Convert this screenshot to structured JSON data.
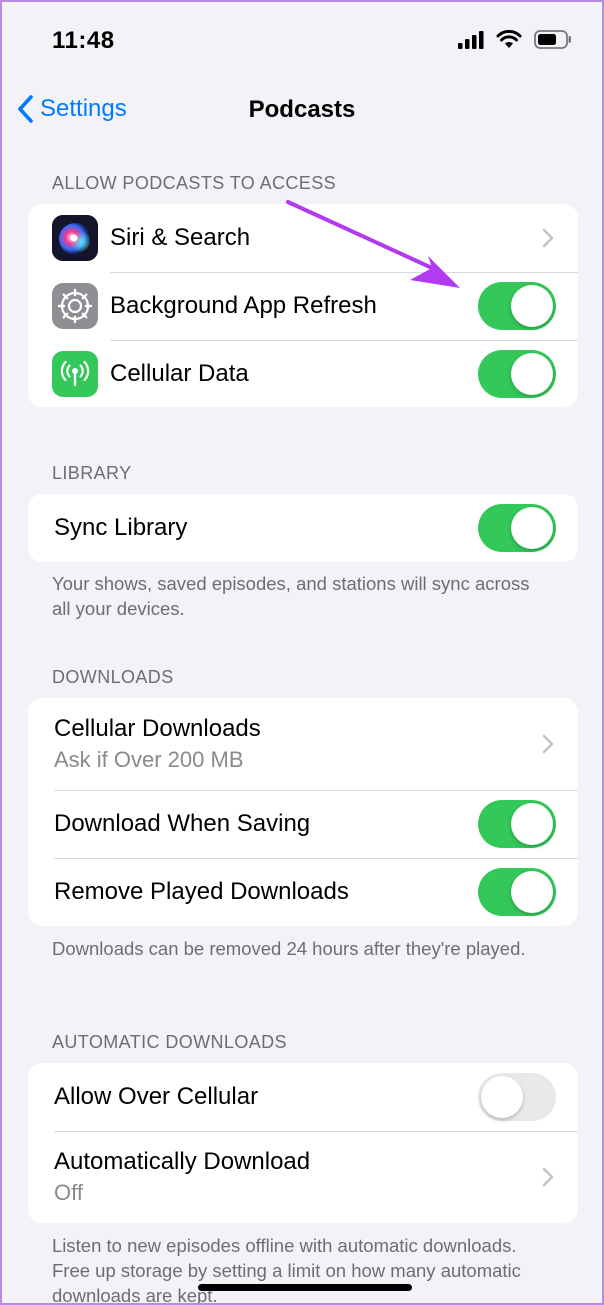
{
  "status_bar": {
    "time": "11:48"
  },
  "nav": {
    "back_label": "Settings",
    "title": "Podcasts"
  },
  "access": {
    "header": "ALLOW PODCASTS TO ACCESS",
    "rows": [
      {
        "label": "Siri & Search",
        "control": "chevron"
      },
      {
        "label": "Background App Refresh",
        "control": "toggle",
        "on": true
      },
      {
        "label": "Cellular Data",
        "control": "toggle",
        "on": true
      }
    ]
  },
  "library": {
    "header": "LIBRARY",
    "sync_label": "Sync Library",
    "sync_on": true,
    "note": "Your shows, saved episodes, and stations will sync across all your devices."
  },
  "downloads": {
    "header": "DOWNLOADS",
    "cellular_downloads_label": "Cellular Downloads",
    "cellular_downloads_value": "Ask if Over 200 MB",
    "download_when_saving_label": "Download When Saving",
    "download_when_saving_on": true,
    "remove_played_label": "Remove Played Downloads",
    "remove_played_on": true,
    "note": "Downloads can be removed 24 hours after they're played."
  },
  "auto_downloads": {
    "header": "AUTOMATIC DOWNLOADS",
    "allow_cellular_label": "Allow Over Cellular",
    "allow_cellular_on": false,
    "auto_download_label": "Automatically Download",
    "auto_download_value": "Off",
    "note": "Listen to new episodes offline with automatic downloads. Free up storage by setting a limit on how many automatic downloads are kept."
  },
  "colors": {
    "accent": "#007aff",
    "toggle_on": "#34c759",
    "toggle_off": "#e9e9eb",
    "annotation": "#b23af0",
    "cellular_icon_bg": "#34c759",
    "settings_icon_bg": "#8e8e93"
  },
  "icons": [
    "chevron-left-icon",
    "cellular-signal-icon",
    "wifi-icon",
    "battery-icon",
    "siri-icon",
    "gear-icon",
    "antenna-icon",
    "chevron-right-icon",
    "annotation-arrow-icon"
  ]
}
